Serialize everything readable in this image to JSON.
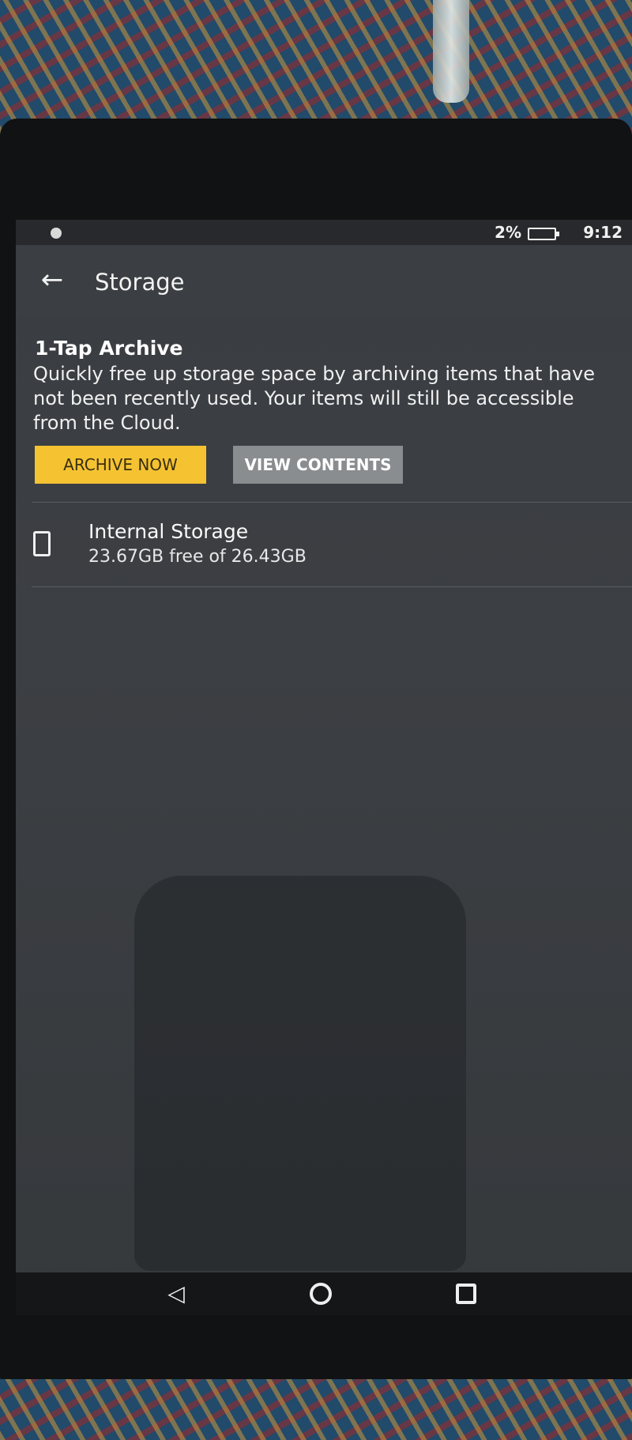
{
  "status_bar": {
    "battery_percent": "2%",
    "time": "9:12",
    "left_icon": "notification-icon",
    "battery_icon": "battery-icon"
  },
  "app_bar": {
    "back_icon": "back-arrow-icon",
    "title": "Storage"
  },
  "archive": {
    "title": "1-Tap Archive",
    "description": "Quickly free up storage space by archiving items that have not been recently used. Your items will still be accessible from the Cloud.",
    "archive_button": "ARCHIVE NOW",
    "view_button": "VIEW CONTENTS"
  },
  "storage": {
    "icon": "device-icon",
    "name": "Internal Storage",
    "detail": "23.67GB free of 26.43GB"
  },
  "nav_bar": {
    "back": "nav-back-icon",
    "home": "nav-home-icon",
    "recents": "nav-recents-icon"
  },
  "colors": {
    "accent": "#f5c332",
    "background": "#3b3e42",
    "secondary_button": "#8a8d90"
  }
}
